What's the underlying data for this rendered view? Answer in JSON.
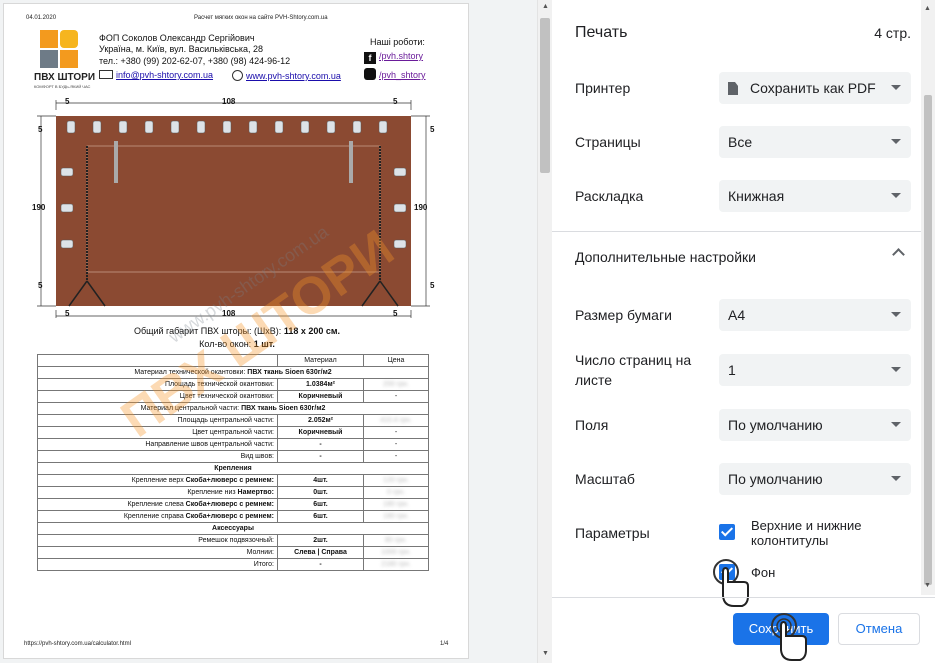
{
  "preview": {
    "date": "04.01.2020",
    "doc_title": "Расчет мягких окон на сайте PVH-Shtory.com.ua",
    "company": {
      "logo_text": "ПВХ ШТОРИ",
      "logo_tagline": "КОМФОРТ В БУДЬ-ЯКИЙ ЧАС",
      "name": "ФОП Соколов Олександр Сергійович",
      "address": "Україна, м. Київ, вул. Васильківська, 28",
      "phone": "тел.: +380 (99) 202-62-07, +380 (98) 424-96-12",
      "email": "info@pvh-shtory.com.ua",
      "site": "www.pvh-shtory.com.ua",
      "works_label": "Наші роботи:",
      "facebook": "/pvh.shtory",
      "instagram": "/pvh_shtory"
    },
    "dims": {
      "top_left": "5",
      "top_mid": "108",
      "top_right": "5",
      "side_top": "5",
      "side_mid": "190",
      "side_bottom": "5",
      "bottom_left": "5",
      "bottom_mid": "108",
      "bottom_right": "5"
    },
    "overall_label": "Общий габарит ПВХ шторы: (ШхВ):",
    "overall_value": "118 х 200 см.",
    "qty_label": "Кол-во окон:",
    "qty_value": "1 шт.",
    "table_header": {
      "material": "Материал",
      "price": "Цена"
    },
    "rows": [
      {
        "kind": "full",
        "label": "Материал технической окантовки:",
        "bold": "ПВХ ткань Sioen 630г/м2"
      },
      {
        "kind": "row",
        "label": "Площадь технической окантовки:",
        "value": "1.0384м²",
        "price": "200 грн."
      },
      {
        "kind": "row",
        "label": "Цвет технической окантовки:",
        "value": "Коричневый",
        "price": "-"
      },
      {
        "kind": "full",
        "label": "Материал центральной части:",
        "bold": "ПВХ ткань Sioen 630г/м2"
      },
      {
        "kind": "row",
        "label": "Площадь центральной части:",
        "value": "2.052м²",
        "price": "410.4 грн."
      },
      {
        "kind": "row",
        "label": "Цвет центральной части:",
        "value": "Коричневый",
        "price": "-"
      },
      {
        "kind": "row",
        "label": "Направление швов центральной части:",
        "value": "-",
        "price": "-"
      },
      {
        "kind": "row",
        "label": "Вид швов:",
        "value": "-",
        "price": "-"
      },
      {
        "kind": "section",
        "label": "Крепления"
      },
      {
        "kind": "row",
        "label": "Крепление верх",
        "bold": "Скоба+люверс с ремнем:",
        "value": "4шт.",
        "price": "120 грн."
      },
      {
        "kind": "row",
        "label": "Крепление низ",
        "bold": "Намертво:",
        "value": "0шт.",
        "price": "0 грн."
      },
      {
        "kind": "row",
        "label": "Крепление слева",
        "bold": "Скоба+люверс с ремнем:",
        "value": "6шт.",
        "price": "180 грн."
      },
      {
        "kind": "row",
        "label": "Крепление справа",
        "bold": "Скоба+люверс с ремнем:",
        "value": "6шт.",
        "price": "180 грн."
      },
      {
        "kind": "section",
        "label": "Аксессуары"
      },
      {
        "kind": "row",
        "label": "Ремешок подвязочный:",
        "value": "2шт.",
        "price": "80 грн."
      },
      {
        "kind": "row",
        "label": "Молнии:",
        "value": "Слева | Справа",
        "price": "1000 грн."
      },
      {
        "kind": "row",
        "label": "Итого:",
        "value": "-",
        "price": "2180 грн."
      }
    ],
    "watermark": "ПВХ ШТОРИ",
    "watermark_url": "www.pvh-shtory.com.ua",
    "footer_url": "https://pvh-shtory.com.ua/calculator.html",
    "footer_page": "1/4"
  },
  "panel": {
    "title": "Печать",
    "page_count": "4 стр.",
    "printer_label": "Принтер",
    "printer_value": "Сохранить как PDF",
    "pages_label": "Страницы",
    "pages_value": "Все",
    "layout_label": "Раскладка",
    "layout_value": "Книжная",
    "more_settings": "Дополнительные настройки",
    "paper_label": "Размер бумаги",
    "paper_value": "A4",
    "per_sheet_label": "Число страниц на листе",
    "per_sheet_value": "1",
    "margins_label": "Поля",
    "margins_value": "По умолчанию",
    "scale_label": "Масштаб",
    "scale_value": "По умолчанию",
    "options_label": "Параметры",
    "headers_footers": "Верхние и нижние колонтитулы",
    "background": "Фон",
    "save_button": "Сохранить",
    "cancel_button": "Отмена"
  },
  "colors": {
    "accent": "#1a73e8",
    "curtain": "#8b4a32",
    "logo_orange": "#f39a1e",
    "logo_gray": "#6e7b87"
  }
}
